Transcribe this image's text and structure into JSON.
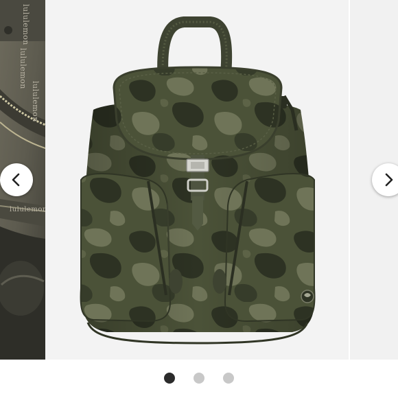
{
  "carousel": {
    "previous_button_icon": "chevron-left-icon",
    "next_button_icon": "chevron-right-icon",
    "indicator_count": 3,
    "active_indicator": 1
  },
  "slides": {
    "previous": {
      "subject": "backpack interior lining",
      "brand_print": [
        "lululemon",
        "lululemon",
        "lululemon",
        "lululemon"
      ]
    },
    "current": {
      "subject": "camouflage drawstring backpack"
    }
  },
  "colors": {
    "camo_dark": "#2d3223",
    "camo_mid": "#4b5238",
    "camo_light": "#6f7458",
    "strap": "#3e4331",
    "indicator_active": "#2b2b2b",
    "indicator_inactive": "#c8c8c8"
  }
}
